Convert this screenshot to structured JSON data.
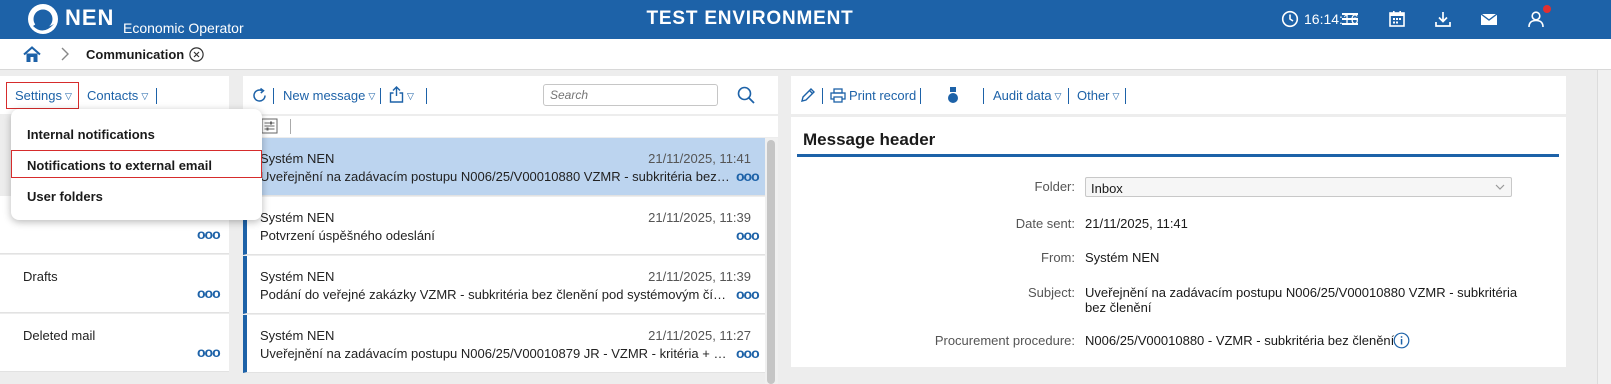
{
  "header": {
    "logo_text": "NEN",
    "logo_subtitle": "Economic Operator",
    "environment": "TEST ENVIRONMENT",
    "clock": "16:14:16",
    "icons": [
      "clock-icon",
      "menu-icon",
      "calendar-icon",
      "download-icon",
      "mail-icon",
      "user-icon"
    ],
    "notification_color": "#e23030",
    "brand_color": "#1d62a8"
  },
  "breadcrumb": {
    "home_icon": "home-icon",
    "current": "Communication"
  },
  "left_toolbar": {
    "settings": "Settings",
    "contacts": "Contacts"
  },
  "settings_menu": {
    "items": [
      "Internal notifications",
      "Notifications to external email",
      "User folders"
    ],
    "highlighted_index": 1
  },
  "folders": [
    {
      "label": ""
    },
    {
      "label": "Drafts"
    },
    {
      "label": "Deleted mail"
    }
  ],
  "middle_toolbar": {
    "new_message": "New message",
    "search_placeholder": "Search"
  },
  "messages": [
    {
      "sender": "Systém NEN",
      "date": "21/11/2025, 11:41",
      "subject": "Uveřejnění na zadávacím postupu N006/25/V00010880 VZMR - subkritéria bez členění",
      "selected": true
    },
    {
      "sender": "Systém NEN",
      "date": "21/11/2025, 11:39",
      "subject": "Potvrzení úspěšného odeslání",
      "selected": false
    },
    {
      "sender": "Systém NEN",
      "date": "21/11/2025, 11:39",
      "subject": "Podání do veřejné zakázky VZMR - subkritéria bez členění pod systémovým číslem",
      "selected": false
    },
    {
      "sender": "Systém NEN",
      "date": "21/11/2025, 11:27",
      "subject": "Uveřejnění na zadávacím postupu N006/25/V00010879 JR - VZMR - kritéria + subkritéria",
      "selected": false
    }
  ],
  "right_toolbar": {
    "print": "Print record",
    "audit": "Audit data",
    "other": "Other"
  },
  "message_header": {
    "title": "Message header",
    "folder_label": "Folder:",
    "folder_value": "Inbox",
    "date_label": "Date sent:",
    "date_value": "21/11/2025, 11:41",
    "from_label": "From:",
    "from_value": "Systém NEN",
    "subject_label": "Subject:",
    "subject_value": "Uveřejnění na zadávacím postupu N006/25/V00010880 VZMR - subkritéria bez členění",
    "procedure_label": "Procurement procedure:",
    "procedure_value": "N006/25/V00010880 - VZMR - subkritéria bez členění"
  }
}
